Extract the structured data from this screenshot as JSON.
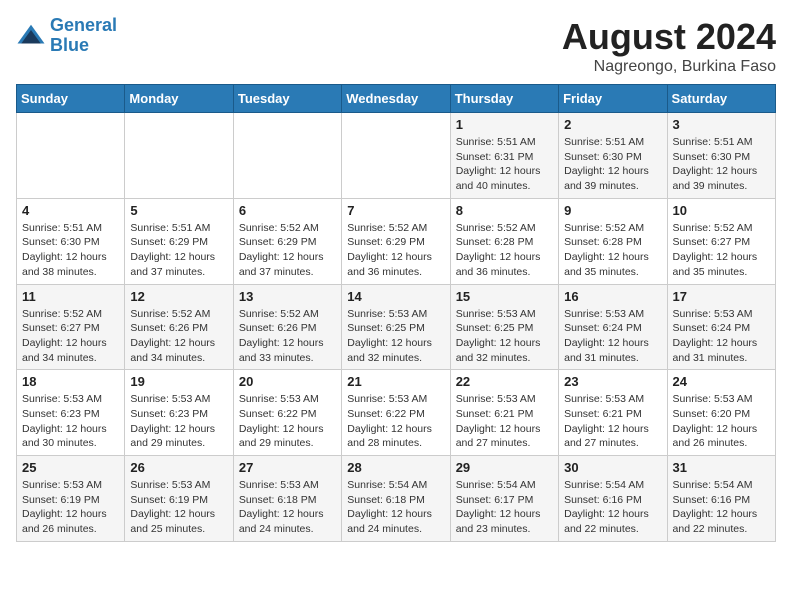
{
  "logo": {
    "line1": "General",
    "line2": "Blue"
  },
  "title": "August 2024",
  "subtitle": "Nagreongo, Burkina Faso",
  "days_of_week": [
    "Sunday",
    "Monday",
    "Tuesday",
    "Wednesday",
    "Thursday",
    "Friday",
    "Saturday"
  ],
  "weeks": [
    [
      {
        "day": "",
        "info": ""
      },
      {
        "day": "",
        "info": ""
      },
      {
        "day": "",
        "info": ""
      },
      {
        "day": "",
        "info": ""
      },
      {
        "day": "1",
        "info": "Sunrise: 5:51 AM\nSunset: 6:31 PM\nDaylight: 12 hours\nand 40 minutes."
      },
      {
        "day": "2",
        "info": "Sunrise: 5:51 AM\nSunset: 6:30 PM\nDaylight: 12 hours\nand 39 minutes."
      },
      {
        "day": "3",
        "info": "Sunrise: 5:51 AM\nSunset: 6:30 PM\nDaylight: 12 hours\nand 39 minutes."
      }
    ],
    [
      {
        "day": "4",
        "info": "Sunrise: 5:51 AM\nSunset: 6:30 PM\nDaylight: 12 hours\nand 38 minutes."
      },
      {
        "day": "5",
        "info": "Sunrise: 5:51 AM\nSunset: 6:29 PM\nDaylight: 12 hours\nand 37 minutes."
      },
      {
        "day": "6",
        "info": "Sunrise: 5:52 AM\nSunset: 6:29 PM\nDaylight: 12 hours\nand 37 minutes."
      },
      {
        "day": "7",
        "info": "Sunrise: 5:52 AM\nSunset: 6:29 PM\nDaylight: 12 hours\nand 36 minutes."
      },
      {
        "day": "8",
        "info": "Sunrise: 5:52 AM\nSunset: 6:28 PM\nDaylight: 12 hours\nand 36 minutes."
      },
      {
        "day": "9",
        "info": "Sunrise: 5:52 AM\nSunset: 6:28 PM\nDaylight: 12 hours\nand 35 minutes."
      },
      {
        "day": "10",
        "info": "Sunrise: 5:52 AM\nSunset: 6:27 PM\nDaylight: 12 hours\nand 35 minutes."
      }
    ],
    [
      {
        "day": "11",
        "info": "Sunrise: 5:52 AM\nSunset: 6:27 PM\nDaylight: 12 hours\nand 34 minutes."
      },
      {
        "day": "12",
        "info": "Sunrise: 5:52 AM\nSunset: 6:26 PM\nDaylight: 12 hours\nand 34 minutes."
      },
      {
        "day": "13",
        "info": "Sunrise: 5:52 AM\nSunset: 6:26 PM\nDaylight: 12 hours\nand 33 minutes."
      },
      {
        "day": "14",
        "info": "Sunrise: 5:53 AM\nSunset: 6:25 PM\nDaylight: 12 hours\nand 32 minutes."
      },
      {
        "day": "15",
        "info": "Sunrise: 5:53 AM\nSunset: 6:25 PM\nDaylight: 12 hours\nand 32 minutes."
      },
      {
        "day": "16",
        "info": "Sunrise: 5:53 AM\nSunset: 6:24 PM\nDaylight: 12 hours\nand 31 minutes."
      },
      {
        "day": "17",
        "info": "Sunrise: 5:53 AM\nSunset: 6:24 PM\nDaylight: 12 hours\nand 31 minutes."
      }
    ],
    [
      {
        "day": "18",
        "info": "Sunrise: 5:53 AM\nSunset: 6:23 PM\nDaylight: 12 hours\nand 30 minutes."
      },
      {
        "day": "19",
        "info": "Sunrise: 5:53 AM\nSunset: 6:23 PM\nDaylight: 12 hours\nand 29 minutes."
      },
      {
        "day": "20",
        "info": "Sunrise: 5:53 AM\nSunset: 6:22 PM\nDaylight: 12 hours\nand 29 minutes."
      },
      {
        "day": "21",
        "info": "Sunrise: 5:53 AM\nSunset: 6:22 PM\nDaylight: 12 hours\nand 28 minutes."
      },
      {
        "day": "22",
        "info": "Sunrise: 5:53 AM\nSunset: 6:21 PM\nDaylight: 12 hours\nand 27 minutes."
      },
      {
        "day": "23",
        "info": "Sunrise: 5:53 AM\nSunset: 6:21 PM\nDaylight: 12 hours\nand 27 minutes."
      },
      {
        "day": "24",
        "info": "Sunrise: 5:53 AM\nSunset: 6:20 PM\nDaylight: 12 hours\nand 26 minutes."
      }
    ],
    [
      {
        "day": "25",
        "info": "Sunrise: 5:53 AM\nSunset: 6:19 PM\nDaylight: 12 hours\nand 26 minutes."
      },
      {
        "day": "26",
        "info": "Sunrise: 5:53 AM\nSunset: 6:19 PM\nDaylight: 12 hours\nand 25 minutes."
      },
      {
        "day": "27",
        "info": "Sunrise: 5:53 AM\nSunset: 6:18 PM\nDaylight: 12 hours\nand 24 minutes."
      },
      {
        "day": "28",
        "info": "Sunrise: 5:54 AM\nSunset: 6:18 PM\nDaylight: 12 hours\nand 24 minutes."
      },
      {
        "day": "29",
        "info": "Sunrise: 5:54 AM\nSunset: 6:17 PM\nDaylight: 12 hours\nand 23 minutes."
      },
      {
        "day": "30",
        "info": "Sunrise: 5:54 AM\nSunset: 6:16 PM\nDaylight: 12 hours\nand 22 minutes."
      },
      {
        "day": "31",
        "info": "Sunrise: 5:54 AM\nSunset: 6:16 PM\nDaylight: 12 hours\nand 22 minutes."
      }
    ]
  ]
}
